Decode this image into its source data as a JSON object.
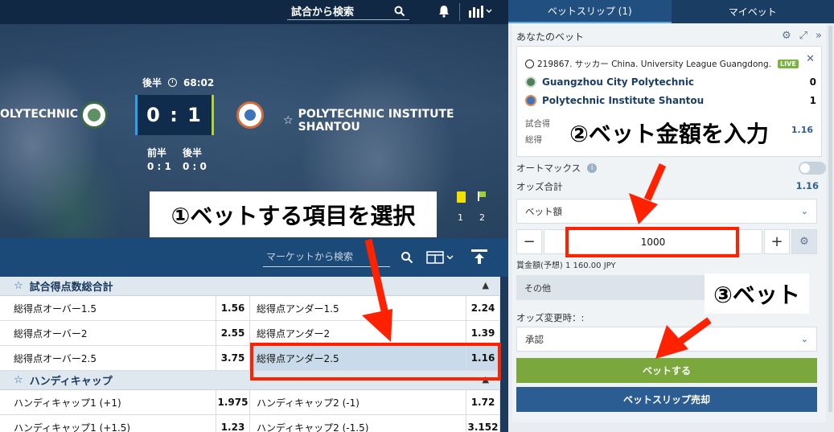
{
  "header": {
    "search_label": "試合から検索"
  },
  "match": {
    "period": "後半",
    "time": "68:02",
    "score": "0 : 1",
    "home_team": "OLYTECHNIC",
    "away_team": "POLYTECHNIC INSTITUTE SHANTOU",
    "half_labels": [
      "前半",
      "後半"
    ],
    "half_scores": [
      "0 : 1",
      "0 : 0"
    ],
    "card_counts": [
      "1",
      "2"
    ]
  },
  "markets_bar": {
    "search_placeholder": "マーケットから検索"
  },
  "markets": [
    {
      "title": "試合得点数総合計",
      "rows": [
        [
          {
            "label": "総得点オーバー1.5",
            "odds": "1.56"
          },
          {
            "label": "総得点アンダー1.5",
            "odds": "2.24"
          }
        ],
        [
          {
            "label": "総得点オーバー2",
            "odds": "2.55"
          },
          {
            "label": "総得点アンダー2",
            "odds": "1.39"
          }
        ],
        [
          {
            "label": "総得点オーバー2.5",
            "odds": "3.75"
          },
          {
            "label": "総得点アンダー2.5",
            "odds": "1.16"
          }
        ]
      ]
    },
    {
      "title": "ハンディキャップ",
      "rows": [
        [
          {
            "label": "ハンディキャップ1 (+1)",
            "odds": "1.975"
          },
          {
            "label": "ハンディキャップ2 (-1)",
            "odds": "1.72"
          }
        ],
        [
          {
            "label": "ハンディキャップ1 (+1.5)",
            "odds": "1.23"
          },
          {
            "label": "ハンディキャップ2 (-1.5)",
            "odds": "3.152"
          }
        ]
      ]
    }
  ],
  "slip": {
    "tabs": [
      "ベットスリップ (1)",
      "マイベット"
    ],
    "your_bet": "あなたのベット",
    "bet_title": "219867. サッカー China. University League Guangdong.",
    "live": "LIVE",
    "team1": "Guangzhou City Polytechnic",
    "team1_score": "0",
    "team2": "Polytechnic Institute Shantou",
    "team2_score": "1",
    "small1": "試合得",
    "small2": "総得",
    "bet_odds": "1.16",
    "automax": "オートマックス",
    "info_mark": "i",
    "odds_total_label": "オッズ合計",
    "odds_total_value": "1.16",
    "bet_amount_label": "ベット額",
    "minus": "−",
    "stake": "1000",
    "plus": "+",
    "payout": "賞金額(予想) 1 160.00 JPY",
    "other": "その他",
    "odds_change": "オッズ変更時：:",
    "approve": "承認",
    "bet_button": "ベットする",
    "sell_button": "ベットスリップ売却"
  },
  "callouts": {
    "c1": "①ベットする項目を選択",
    "c2": "②ベット金額を入力",
    "c3": "③ベット"
  },
  "colors": {
    "accent_red": "#ff2200",
    "bet_green": "#7aa83d",
    "slip_blue": "#2b5d93"
  }
}
